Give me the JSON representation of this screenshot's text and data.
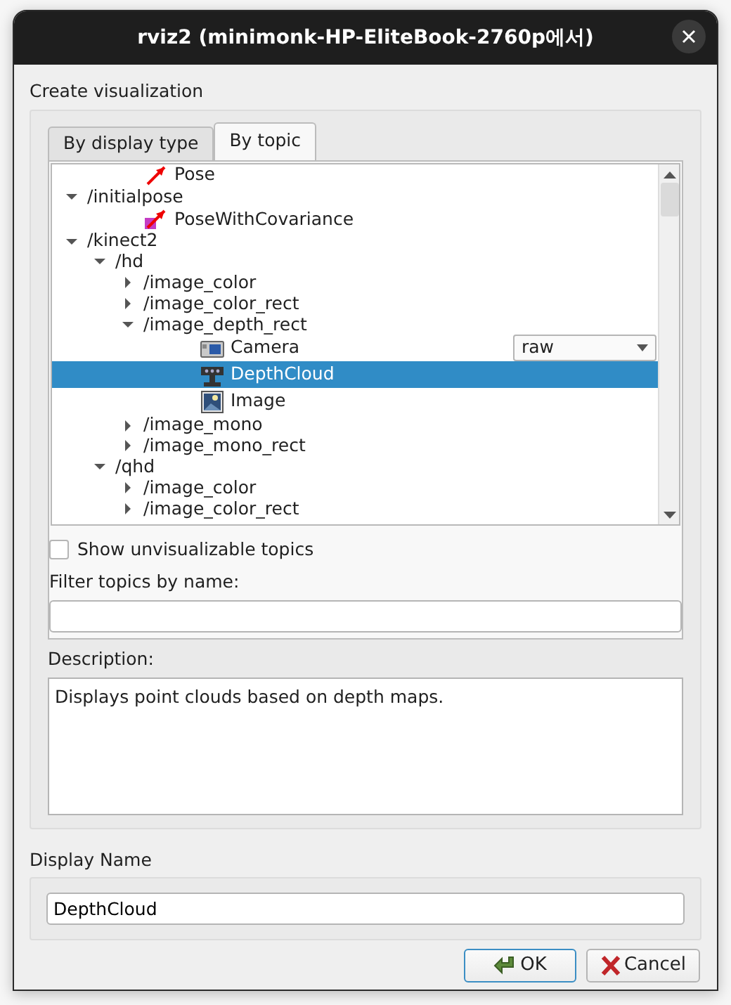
{
  "window": {
    "title": "rviz2 (minimonk-HP-EliteBook-2760p에서)"
  },
  "heading": "Create visualization",
  "tabs": [
    {
      "label": "By display type",
      "selected": false
    },
    {
      "label": "By topic",
      "selected": true
    }
  ],
  "tree": [
    {
      "children": [
        {
          "kind": "pose",
          "label": "Pose",
          "selected": false
        }
      ]
    },
    {
      "kind": "topic",
      "label": "/initialpose",
      "expanded": true,
      "selected": false,
      "children": [
        {
          "kind": "pose-covariance",
          "label": "PoseWithCovariance",
          "selected": false
        }
      ]
    },
    {
      "kind": "topic",
      "label": "/kinect2",
      "expanded": true,
      "selected": false,
      "children": [
        {
          "kind": "topic",
          "label": "/hd",
          "expanded": true,
          "selected": false,
          "children": [
            {
              "kind": "topic",
              "label": "/image_color",
              "expanded": false,
              "selected": false
            },
            {
              "kind": "topic",
              "label": "/image_color_rect",
              "expanded": false,
              "selected": false
            },
            {
              "kind": "topic",
              "label": "/image_depth_rect",
              "expanded": true,
              "selected": false,
              "children": [
                {
                  "kind": "camera",
                  "label": "Camera",
                  "selected": false,
                  "transport": "raw"
                },
                {
                  "kind": "depthcloud",
                  "label": "DepthCloud",
                  "selected": true
                },
                {
                  "kind": "image",
                  "label": "Image",
                  "selected": false
                }
              ]
            },
            {
              "kind": "topic",
              "label": "/image_mono",
              "expanded": false,
              "selected": false
            },
            {
              "kind": "topic",
              "label": "/image_mono_rect",
              "expanded": false,
              "selected": false
            }
          ]
        },
        {
          "kind": "topic",
          "label": "/qhd",
          "expanded": true,
          "selected": false,
          "children": [
            {
              "kind": "topic",
              "label": "/image_color",
              "expanded": false,
              "selected": false
            },
            {
              "kind": "topic",
              "label": "/image_color_rect",
              "expanded": false,
              "selected": false
            }
          ]
        }
      ]
    }
  ],
  "show_unvisualizable": {
    "label": "Show unvisualizable topics",
    "checked": false
  },
  "filter": {
    "label": "Filter topics by name:"
  },
  "description": {
    "label": "Description:",
    "text": "Displays point clouds based on depth maps."
  },
  "display_name": {
    "label": "Display Name",
    "value": "DepthCloud"
  },
  "buttons": [
    {
      "kind": "ok",
      "label": "OK",
      "default": true
    },
    {
      "kind": "cancel",
      "label": "Cancel",
      "default": false
    }
  ]
}
